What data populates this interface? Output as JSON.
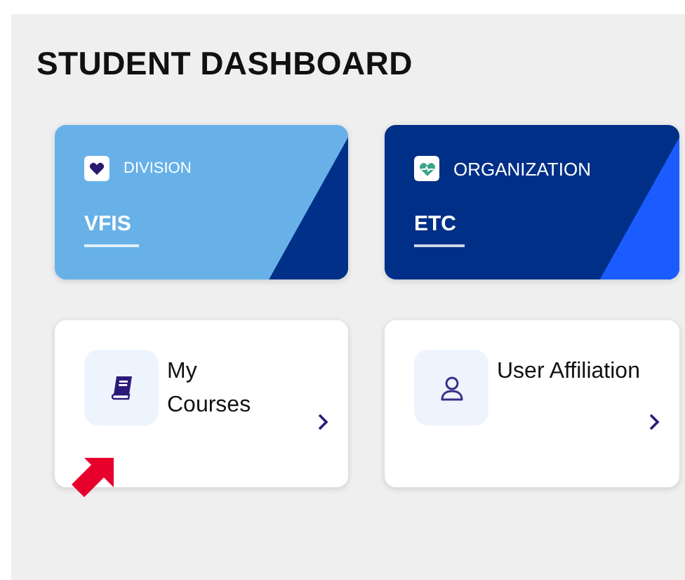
{
  "title": "STUDENT DASHBOARD",
  "org_cards": [
    {
      "kind": "division",
      "label": "DIVISION",
      "value": "VFIS"
    },
    {
      "kind": "organization",
      "label": "ORGANIZATION",
      "value": "ETC"
    }
  ],
  "link_cards": [
    {
      "kind": "courses",
      "label": "My Courses"
    },
    {
      "kind": "affiliation",
      "label": "User Affiliation"
    }
  ]
}
